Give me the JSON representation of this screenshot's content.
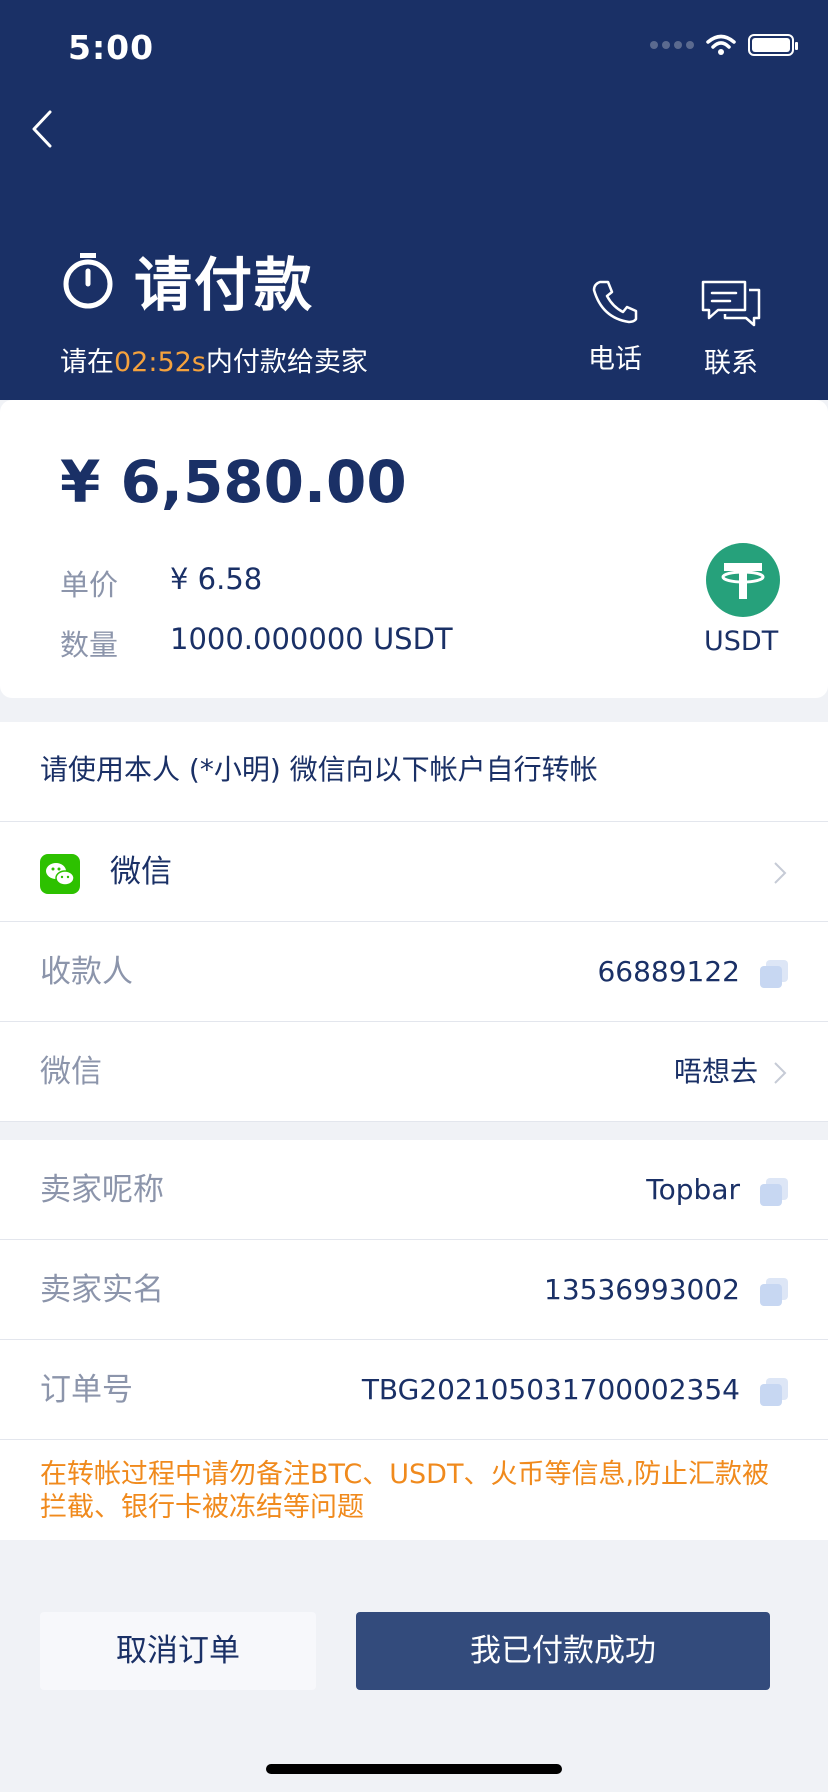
{
  "status_bar": {
    "time": "5:00"
  },
  "header": {
    "title": "请付款",
    "countdown_prefix": "请在",
    "countdown_time": "02:52s",
    "countdown_suffix": "内付款给卖家",
    "actions": [
      {
        "label": "电话",
        "icon": "phone-icon"
      },
      {
        "label": "联系",
        "icon": "chat-icon"
      }
    ]
  },
  "order_summary": {
    "amount": "¥ 6,580.00",
    "unit_price_label": "单价",
    "unit_price_value": "¥ 6.58",
    "quantity_label": "数量",
    "quantity_value": "1000.000000 USDT",
    "coin_label": "USDT"
  },
  "payment": {
    "instruction": "请使用本人 (*小明) 微信向以下帐户自行转帐",
    "method_name": "微信",
    "rows": [
      {
        "label": "收款人",
        "value": "66889122",
        "action": "copy"
      },
      {
        "label": "微信",
        "value": "唔想去",
        "action": "chevron"
      }
    ]
  },
  "seller": {
    "rows": [
      {
        "label": "卖家呢称",
        "value": "Topbar"
      },
      {
        "label": "卖家实名",
        "value": "13536993002"
      },
      {
        "label": "订单号",
        "value": "TBG202105031700002354"
      }
    ],
    "warning": "在转帐过程中请勿备注BTC、USDT、火币等信息,防止汇款被拦截、银行卡被冻结等问题"
  },
  "buttons": {
    "cancel": "取消订单",
    "paid": "我已付款成功"
  },
  "colors": {
    "header_bg": "#1a3066",
    "accent_orange": "#f5a23d",
    "primary_button": "#334b7c",
    "usdt_green": "#26a17b",
    "wechat_green": "#2dc100"
  }
}
